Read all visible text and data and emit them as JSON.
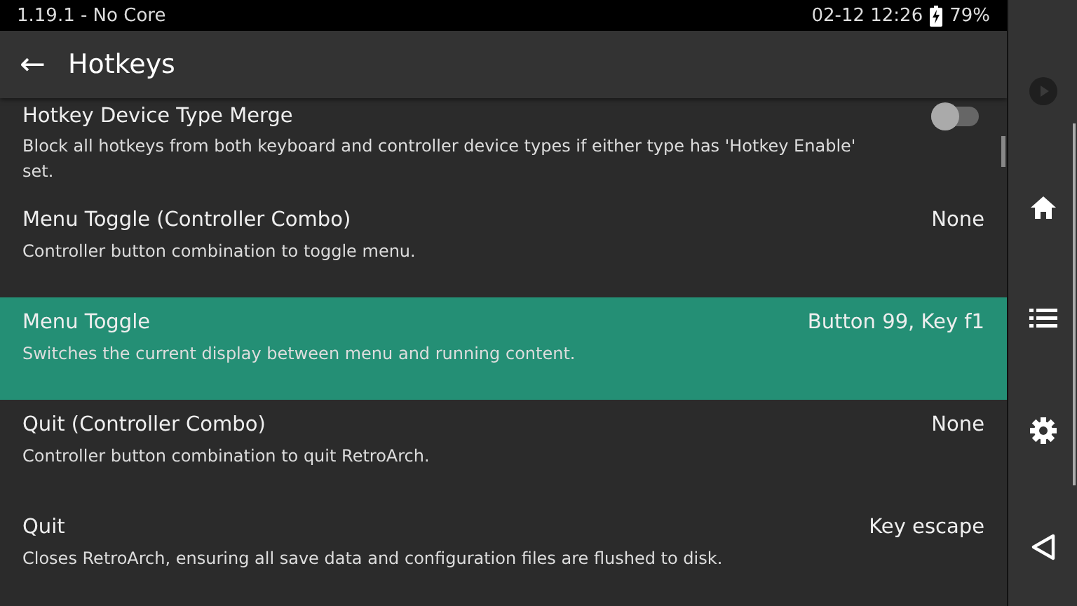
{
  "status_bar": {
    "version": "1.19.1 - No Core",
    "datetime": "02-12 12:26",
    "battery": "79%"
  },
  "header": {
    "back": "←",
    "title": "Hotkeys"
  },
  "items": [
    {
      "kind": "toggle",
      "title": "Hotkey Device Type Merge",
      "description": "Block all hotkeys from both keyboard and controller device types if either type has 'Hotkey Enable' set.",
      "on": false,
      "selected": false
    },
    {
      "kind": "value",
      "title": "Menu Toggle (Controller Combo)",
      "value": "None",
      "description": "Controller button combination to toggle menu.",
      "selected": false
    },
    {
      "kind": "value",
      "title": "Menu Toggle",
      "value": "Button 99, Key f1",
      "description": "Switches the current display between menu and running content.",
      "selected": true
    },
    {
      "kind": "value",
      "title": "Quit (Controller Combo)",
      "value": "None",
      "description": "Controller button combination to quit RetroArch.",
      "selected": false
    },
    {
      "kind": "value",
      "title": "Quit",
      "value": "Key escape",
      "description": "Closes RetroArch, ensuring all save data and configuration files are flushed to disk.",
      "selected": false
    }
  ]
}
